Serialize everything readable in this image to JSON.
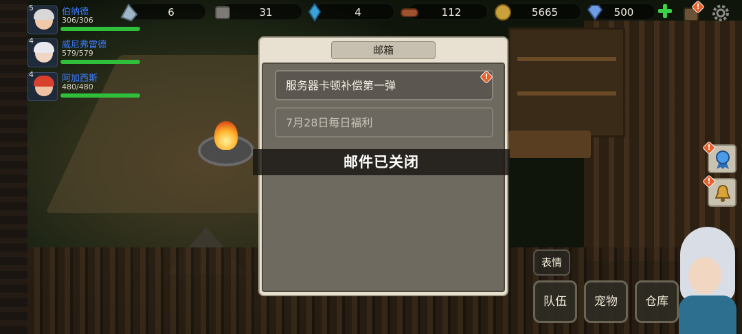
{
  "resources": [
    {
      "icon": "stone-shard-icon",
      "value": "6"
    },
    {
      "icon": "iron-ore-icon",
      "value": "31"
    },
    {
      "icon": "crystal-icon",
      "value": "4"
    },
    {
      "icon": "wood-log-icon",
      "value": "112"
    },
    {
      "icon": "gold-coin-icon",
      "value": "5665"
    },
    {
      "icon": "diamond-icon",
      "value": "500"
    }
  ],
  "party": [
    {
      "level": "5",
      "name": "伯纳德",
      "hp": "306/306",
      "hp_fraction": 1.0
    },
    {
      "level": "4",
      "name": "威尼弗雷德",
      "hp": "579/579",
      "hp_fraction": 1.0
    },
    {
      "level": "4",
      "name": "阿加西斯",
      "hp": "480/480",
      "hp_fraction": 1.0
    }
  ],
  "mailbox": {
    "title": "邮箱",
    "items": [
      {
        "subject": "服务器卡顿补偿第一弹",
        "unread": true
      },
      {
        "subject": "7月28日每日福利",
        "unread": false
      }
    ]
  },
  "toast": "邮件已关闭",
  "bottom": {
    "emote_label": "表情",
    "team_label": "队伍",
    "pet_label": "宠物",
    "storage_label": "仓库"
  },
  "alert_mark": "!",
  "colors": {
    "accent_alert": "#e9602a",
    "hp_bar": "#2fbf3a",
    "party_name": "#3c7cff"
  }
}
